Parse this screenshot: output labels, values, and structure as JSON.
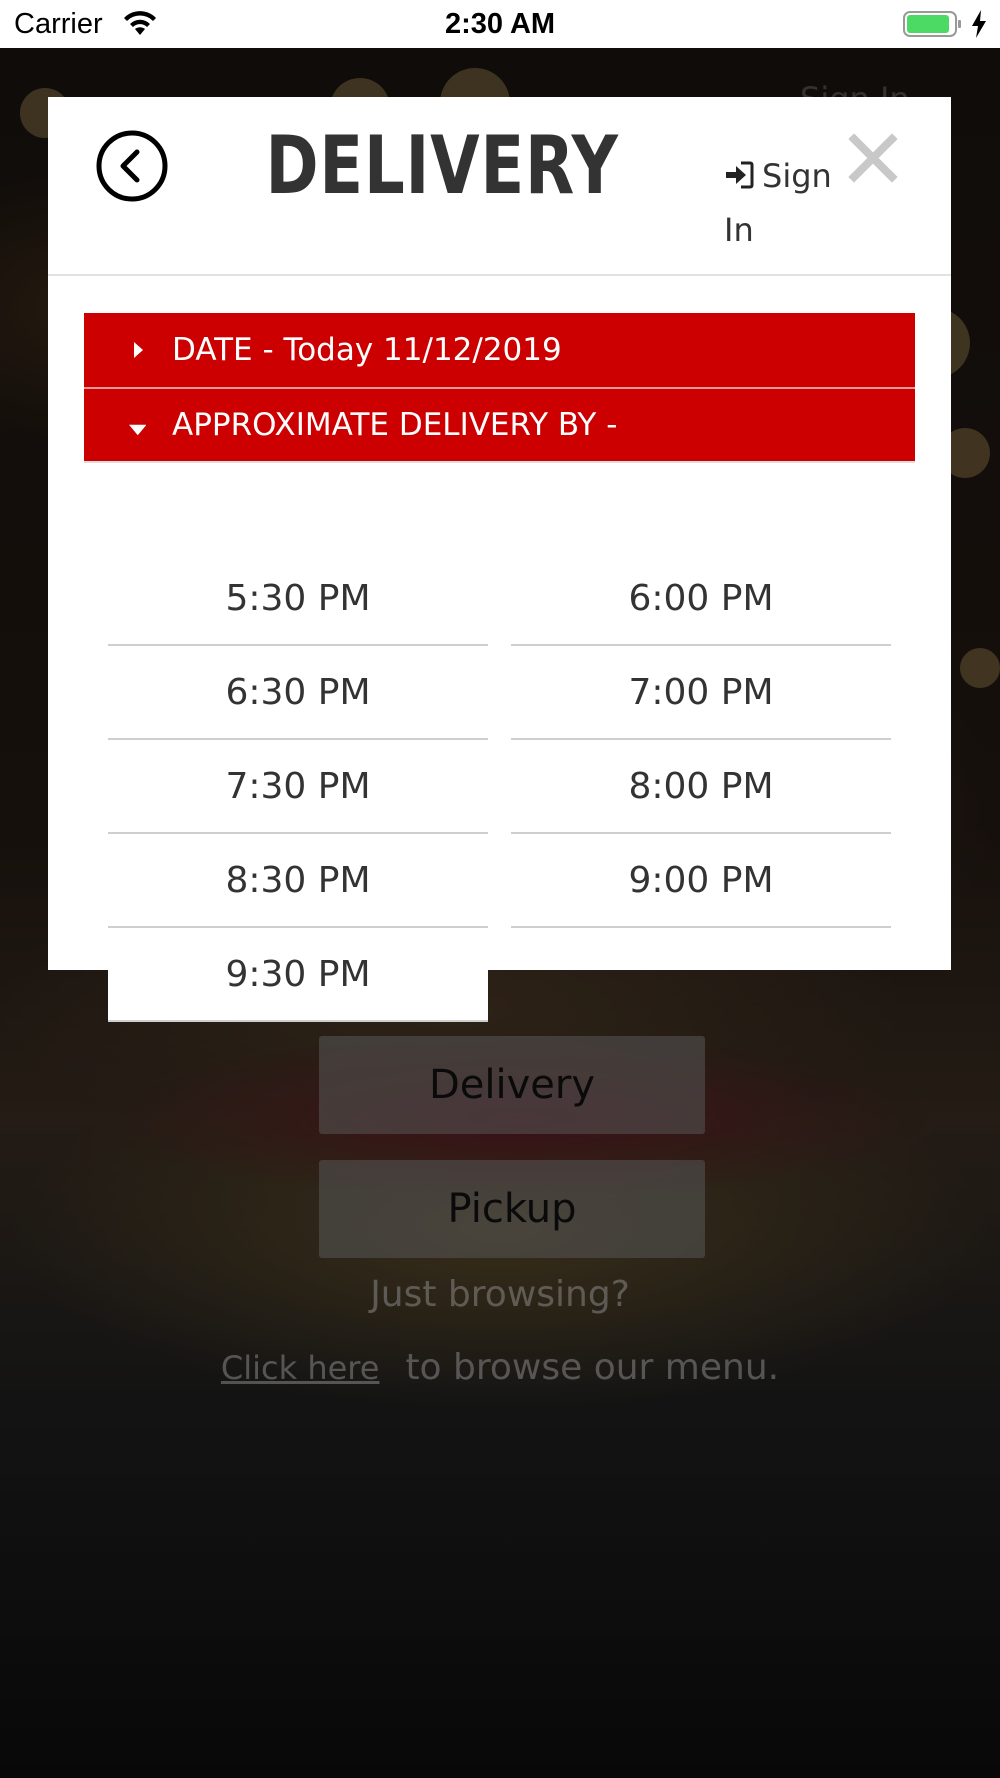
{
  "status_bar": {
    "carrier": "Carrier",
    "time": "2:30 AM"
  },
  "background": {
    "signin_ghost": "Sign In",
    "delivery_button": "Delivery",
    "pickup_button": "Pickup",
    "browsing_text": "Just browsing?",
    "click_here_link": "Click here",
    "browse_menu_text": "to browse our menu."
  },
  "modal": {
    "title": "DELIVERY",
    "signin_label": "Sign In",
    "date_row": "DATE - Today 11/12/2019",
    "approx_row": "APPROXIMATE DELIVERY BY -",
    "time_slots": [
      "5:30 PM",
      "6:00 PM",
      "6:30 PM",
      "7:00 PM",
      "7:30 PM",
      "8:00 PM",
      "8:30 PM",
      "9:00 PM",
      "9:30 PM"
    ]
  },
  "colors": {
    "accent_red": "#cc0000",
    "title_text": "#333333",
    "battery_green": "#4cd964"
  },
  "icons": {
    "back": "chevron-left-circle-icon",
    "close": "close-icon",
    "signin": "sign-in-icon",
    "date_collapsed": "caret-right-icon",
    "approx_expanded": "caret-down-icon"
  }
}
